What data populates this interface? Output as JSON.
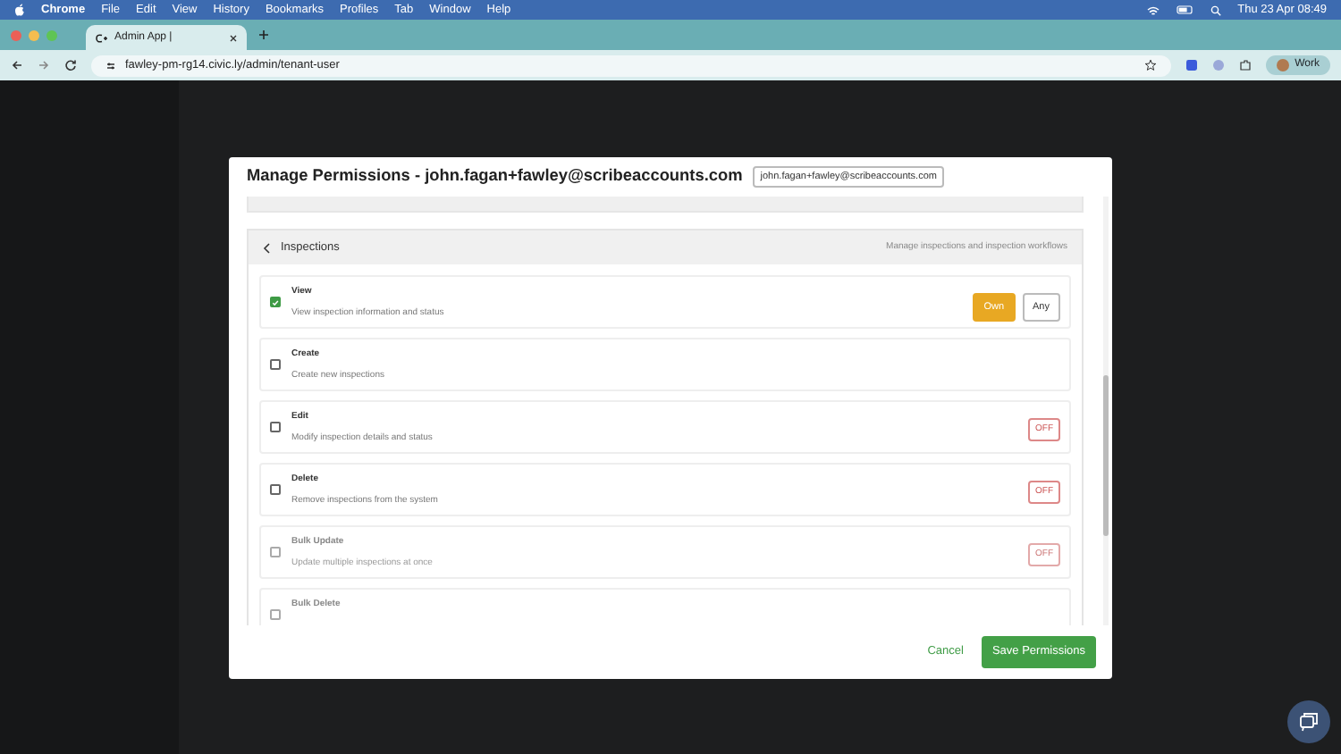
{
  "menu_bar": {
    "app": "Chrome",
    "items": [
      "File",
      "Edit",
      "View",
      "History",
      "Bookmarks",
      "Profiles",
      "Tab",
      "Window",
      "Help"
    ],
    "clock": "Thu 23 Apr 08:49"
  },
  "browser": {
    "tab_title": "Admin App |",
    "url": "fawley-pm-rg14.civic.ly/admin/tenant-user",
    "profile": "Work"
  },
  "modal": {
    "title": "Manage Permissions - john.fagan+fawley@scribeaccounts.com",
    "user_badge": "john.fagan+fawley@scribeaccounts.com",
    "section": {
      "title": "Inspections",
      "description": "Manage inspections and inspection workflows",
      "permissions": [
        {
          "kind": "scope",
          "name": "View",
          "description": "View inspection information and status",
          "checked": true,
          "disabled": false,
          "options": [
            {
              "label": "Own",
              "selected": true
            },
            {
              "label": "Any",
              "selected": false
            }
          ]
        },
        {
          "kind": "none",
          "name": "Create",
          "description": "Create new inspections",
          "checked": false,
          "disabled": false
        },
        {
          "kind": "toggle",
          "name": "Edit",
          "description": "Modify inspection details and status",
          "checked": false,
          "disabled": false,
          "toggle": "OFF"
        },
        {
          "kind": "toggle",
          "name": "Delete",
          "description": "Remove inspections from the system",
          "checked": false,
          "disabled": false,
          "toggle": "OFF"
        },
        {
          "kind": "toggle",
          "name": "Bulk Update",
          "description": "Update multiple inspections at once",
          "checked": false,
          "disabled": true,
          "toggle": "OFF"
        },
        {
          "kind": "toggle",
          "name": "Bulk Delete",
          "checked": false,
          "disabled": true
        }
      ]
    },
    "buttons": {
      "cancel": "Cancel",
      "save": "Save Permissions"
    }
  }
}
